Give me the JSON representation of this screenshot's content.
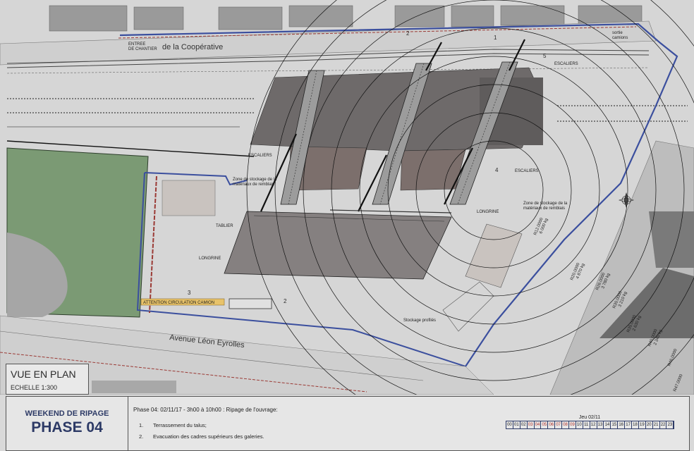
{
  "plan": {
    "street_top": "de la Coopérative",
    "entree_chantier_1": "ENTREE",
    "entree_chantier_2": "DE CHANTIER",
    "street_bottom": "Avenue Léon Eyrolles",
    "escaliers_top": "ESCALIERS",
    "escaliers_mid_left": "ESCALIERS",
    "escaliers_mid_right": "ESCALIERS",
    "stockage_left_1": "Zone de stockage de la",
    "stockage_left_2": "matériaux de remblais",
    "stockage_right_1": "Zone de stockage de la",
    "stockage_right_2": "matériaux de remblais",
    "tablier": "TABLIER",
    "longrine_left": "LONGRINE",
    "longrine_right": "LONGRINE",
    "attention": "ATTENTION CIRCULATION CAMION",
    "stockage_profiles": "Stockage profilés",
    "sortie": "sortie",
    "camions": "camions",
    "radius_1": "R12.0000",
    "radius_1_load": "6 000 kg",
    "radius_2": "R20.0000",
    "radius_2_load": "4 870 kg",
    "radius_3": "R26.0000",
    "radius_3_load": "3 780 kg",
    "radius_4": "R30.0000",
    "radius_4_load": "3 210 kg",
    "radius_5": "R35.0000",
    "radius_5_load": "2 630 kg",
    "radius_6": "R40.0000",
    "radius_6_load": "2 340 kg",
    "radius_7": "R46.0000",
    "radius_8": "R47.0000",
    "axis_1": "1",
    "axis_2": "2",
    "axis_3": "3",
    "axis_4": "4",
    "axis_5": "5"
  },
  "title_box": {
    "title": "VUE EN PLAN",
    "scale": "ECHELLE  1:300"
  },
  "cartouche": {
    "weekend": "WEEKEND DE RIPAGE",
    "phase": "PHASE 04",
    "description": "Phase 04: 02/11/17 - 3h00 à 10h00 : Ripage de l'ouvrage:",
    "steps": [
      {
        "num": "1.",
        "text": "Terrassement du talus;"
      },
      {
        "num": "2.",
        "text": "Evacuation des cadres supérieurs des galeries."
      }
    ],
    "day": "Jeu 02/11",
    "hours": [
      "00",
      "01",
      "02",
      "03",
      "04",
      "05",
      "06",
      "07",
      "08",
      "09",
      "10",
      "11",
      "12",
      "13",
      "14",
      "15",
      "16",
      "17",
      "18",
      "19",
      "20",
      "21",
      "22",
      "23"
    ],
    "highlighted_hours": [
      "03",
      "04",
      "05",
      "06",
      "07",
      "08",
      "09"
    ]
  },
  "colors": {
    "fence_blue": "#3b4f9e",
    "fence_red": "#9b3a35",
    "grass": "#7b9a74",
    "building_dark": "#6e6a6a",
    "building_brown": "#7c6f6c",
    "title_blue": "#2d3a66"
  }
}
